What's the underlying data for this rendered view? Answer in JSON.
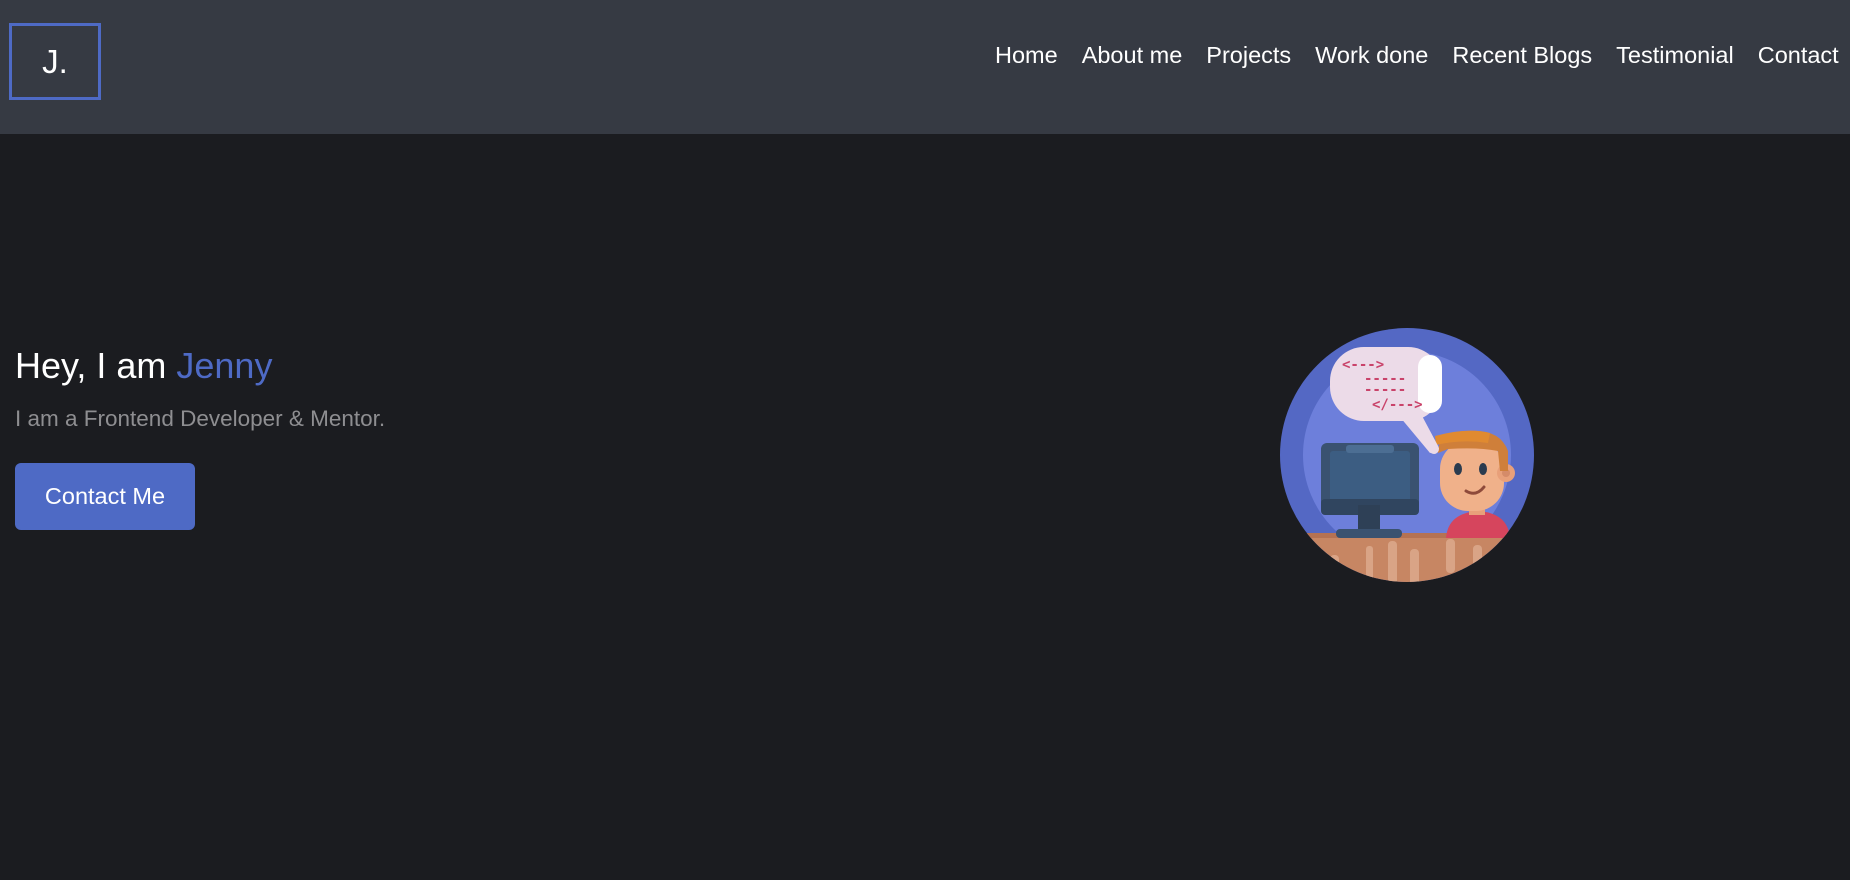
{
  "navbar": {
    "logo_text": "J.",
    "links": [
      "Home",
      "About me",
      "Projects",
      "Work done",
      "Recent Blogs",
      "Testimonial",
      "Contact"
    ]
  },
  "hero": {
    "greeting": "Hey, I am ",
    "name": "Jenny",
    "subtitle": "I am a Frontend Developer & Mentor.",
    "cta_label": "Contact Me",
    "illustration": {
      "icon": "developer-at-computer-illustration",
      "code_lines": [
        "<--->",
        "-----",
        "-----",
        "</--->"
      ]
    }
  },
  "colors": {
    "accent": "#4e6ac5",
    "navbar_bg": "#363a43",
    "page_bg": "#1b1c20",
    "subtitle_text": "#8e8e91"
  }
}
